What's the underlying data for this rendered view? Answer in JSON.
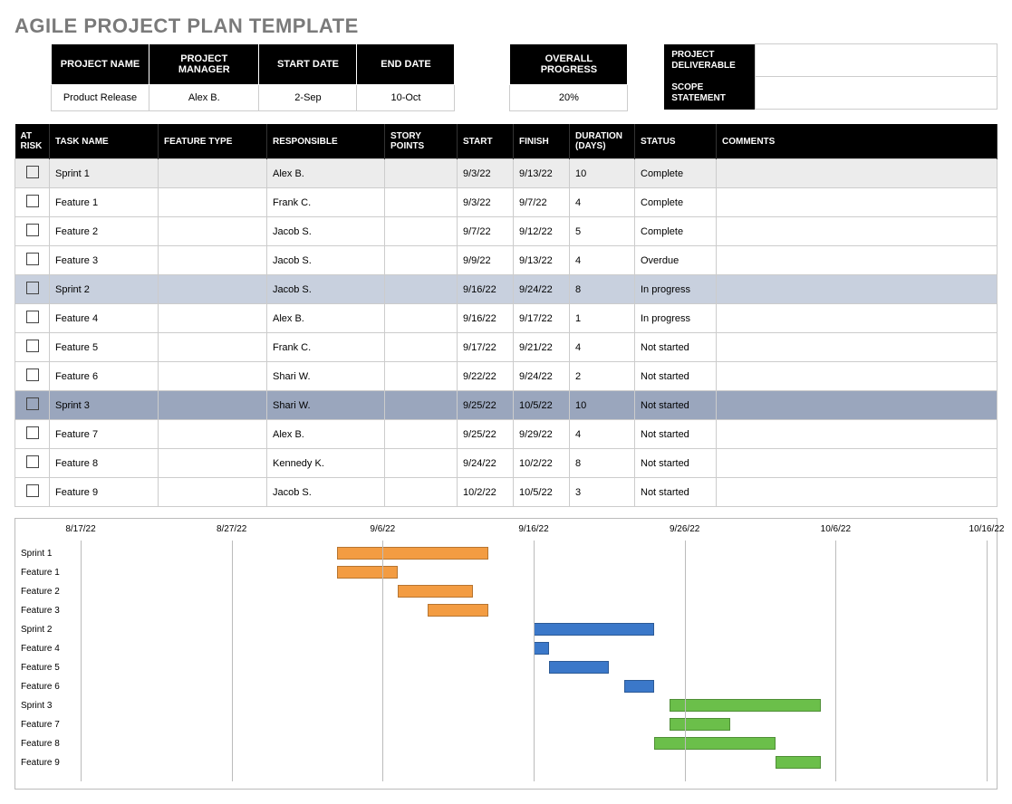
{
  "title": "AGILE PROJECT PLAN TEMPLATE",
  "project_info": {
    "headers": {
      "name": "PROJECT NAME",
      "manager": "PROJECT MANAGER",
      "start": "START DATE",
      "end": "END DATE"
    },
    "values": {
      "name": "Product Release",
      "manager": "Alex B.",
      "start": "2-Sep",
      "end": "10-Oct"
    }
  },
  "progress": {
    "header": "OVERALL PROGRESS",
    "value": "20%"
  },
  "deliverable": {
    "header1": "PROJECT DELIVERABLE",
    "header2": "SCOPE STATEMENT",
    "value1": "",
    "value2": ""
  },
  "task_headers": {
    "risk": "AT RISK",
    "task": "TASK NAME",
    "feature": "FEATURE TYPE",
    "responsible": "RESPONSIBLE",
    "points": "STORY POINTS",
    "start": "START",
    "finish": "FINISH",
    "duration": "DURATION (DAYS)",
    "status": "STATUS",
    "comments": "COMMENTS"
  },
  "tasks": [
    {
      "shade": "light",
      "task": "Sprint 1",
      "feature": "",
      "responsible": "Alex B.",
      "points": "",
      "start": "9/3/22",
      "finish": "9/13/22",
      "duration": "10",
      "status": "Complete",
      "comments": ""
    },
    {
      "shade": "",
      "task": "Feature 1",
      "feature": "",
      "responsible": "Frank C.",
      "points": "",
      "start": "9/3/22",
      "finish": "9/7/22",
      "duration": "4",
      "status": "Complete",
      "comments": ""
    },
    {
      "shade": "",
      "task": "Feature 2",
      "feature": "",
      "responsible": "Jacob S.",
      "points": "",
      "start": "9/7/22",
      "finish": "9/12/22",
      "duration": "5",
      "status": "Complete",
      "comments": ""
    },
    {
      "shade": "",
      "task": "Feature 3",
      "feature": "",
      "responsible": "Jacob S.",
      "points": "",
      "start": "9/9/22",
      "finish": "9/13/22",
      "duration": "4",
      "status": "Overdue",
      "comments": ""
    },
    {
      "shade": "med",
      "task": "Sprint 2",
      "feature": "",
      "responsible": "Jacob S.",
      "points": "",
      "start": "9/16/22",
      "finish": "9/24/22",
      "duration": "8",
      "status": "In progress",
      "comments": ""
    },
    {
      "shade": "",
      "task": "Feature 4",
      "feature": "",
      "responsible": "Alex B.",
      "points": "",
      "start": "9/16/22",
      "finish": "9/17/22",
      "duration": "1",
      "status": "In progress",
      "comments": ""
    },
    {
      "shade": "",
      "task": "Feature 5",
      "feature": "",
      "responsible": "Frank C.",
      "points": "",
      "start": "9/17/22",
      "finish": "9/21/22",
      "duration": "4",
      "status": "Not started",
      "comments": ""
    },
    {
      "shade": "",
      "task": "Feature 6",
      "feature": "",
      "responsible": "Shari W.",
      "points": "",
      "start": "9/22/22",
      "finish": "9/24/22",
      "duration": "2",
      "status": "Not started",
      "comments": ""
    },
    {
      "shade": "dark",
      "task": "Sprint 3",
      "feature": "",
      "responsible": "Shari W.",
      "points": "",
      "start": "9/25/22",
      "finish": "10/5/22",
      "duration": "10",
      "status": "Not started",
      "comments": ""
    },
    {
      "shade": "",
      "task": "Feature 7",
      "feature": "",
      "responsible": "Alex B.",
      "points": "",
      "start": "9/25/22",
      "finish": "9/29/22",
      "duration": "4",
      "status": "Not started",
      "comments": ""
    },
    {
      "shade": "",
      "task": "Feature 8",
      "feature": "",
      "responsible": "Kennedy K.",
      "points": "",
      "start": "9/24/22",
      "finish": "10/2/22",
      "duration": "8",
      "status": "Not started",
      "comments": ""
    },
    {
      "shade": "",
      "task": "Feature 9",
      "feature": "",
      "responsible": "Jacob S.",
      "points": "",
      "start": "10/2/22",
      "finish": "10/5/22",
      "duration": "3",
      "status": "Not started",
      "comments": ""
    }
  ],
  "chart_data": {
    "type": "bar",
    "orientation": "horizontal-gantt",
    "x_axis": {
      "min": "8/17/22",
      "max": "10/16/22",
      "ticks": [
        "8/17/22",
        "8/27/22",
        "9/6/22",
        "9/16/22",
        "9/26/22",
        "10/6/22",
        "10/16/22"
      ]
    },
    "rows": [
      {
        "label": "Sprint 1",
        "start": "9/3/22",
        "end": "9/13/22",
        "color": "orange"
      },
      {
        "label": "Feature 1",
        "start": "9/3/22",
        "end": "9/7/22",
        "color": "orange"
      },
      {
        "label": "Feature 2",
        "start": "9/7/22",
        "end": "9/12/22",
        "color": "orange"
      },
      {
        "label": "Feature 3",
        "start": "9/9/22",
        "end": "9/13/22",
        "color": "orange"
      },
      {
        "label": "Sprint 2",
        "start": "9/16/22",
        "end": "9/24/22",
        "color": "blue"
      },
      {
        "label": "Feature 4",
        "start": "9/16/22",
        "end": "9/17/22",
        "color": "blue"
      },
      {
        "label": "Feature 5",
        "start": "9/17/22",
        "end": "9/21/22",
        "color": "blue"
      },
      {
        "label": "Feature 6",
        "start": "9/22/22",
        "end": "9/24/22",
        "color": "blue"
      },
      {
        "label": "Sprint 3",
        "start": "9/25/22",
        "end": "10/5/22",
        "color": "green"
      },
      {
        "label": "Feature 7",
        "start": "9/25/22",
        "end": "9/29/22",
        "color": "green"
      },
      {
        "label": "Feature 8",
        "start": "9/24/22",
        "end": "10/2/22",
        "color": "green"
      },
      {
        "label": "Feature 9",
        "start": "10/2/22",
        "end": "10/5/22",
        "color": "green"
      }
    ]
  }
}
